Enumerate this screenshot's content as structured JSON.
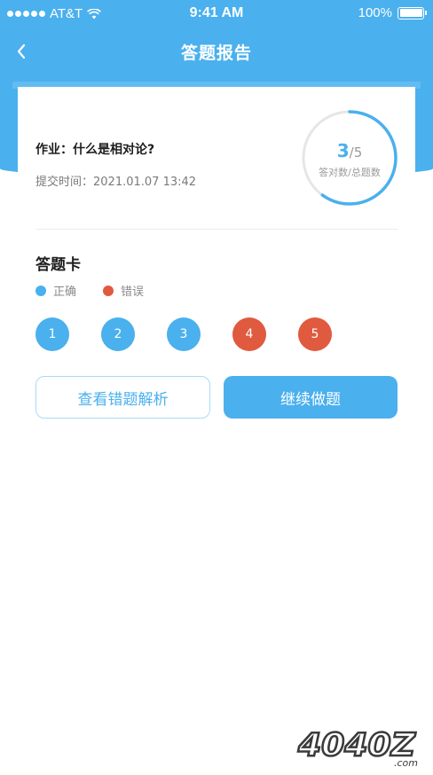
{
  "status_bar": {
    "carrier": "AT&T",
    "time": "9:41 AM",
    "battery": "100%"
  },
  "nav": {
    "title": "答题报告",
    "back_icon": "chevron-left-icon"
  },
  "report": {
    "homework_title": "作业：什么是相对论?",
    "submit_time": "提交时间：2021.01.07 13:42",
    "correct_count": "3",
    "total_count": "/5",
    "score_label": "答对数/总题数",
    "score_fraction": 0.6
  },
  "answer_card": {
    "title": "答题卡",
    "legend": [
      {
        "label": "正确",
        "color": "#4ab0ee"
      },
      {
        "label": "错误",
        "color": "#e05a3f"
      }
    ],
    "questions": [
      {
        "number": "1",
        "status": "correct"
      },
      {
        "number": "2",
        "status": "correct"
      },
      {
        "number": "3",
        "status": "correct"
      },
      {
        "number": "4",
        "status": "wrong"
      },
      {
        "number": "5",
        "status": "wrong"
      }
    ]
  },
  "actions": {
    "review_label": "查看错题解析",
    "continue_label": "继续做题"
  },
  "colors": {
    "primary": "#4ab0ee",
    "correct": "#4ab0ee",
    "wrong": "#e05a3f"
  },
  "watermark": {
    "text": "4040Z",
    "suffix": ".com"
  }
}
